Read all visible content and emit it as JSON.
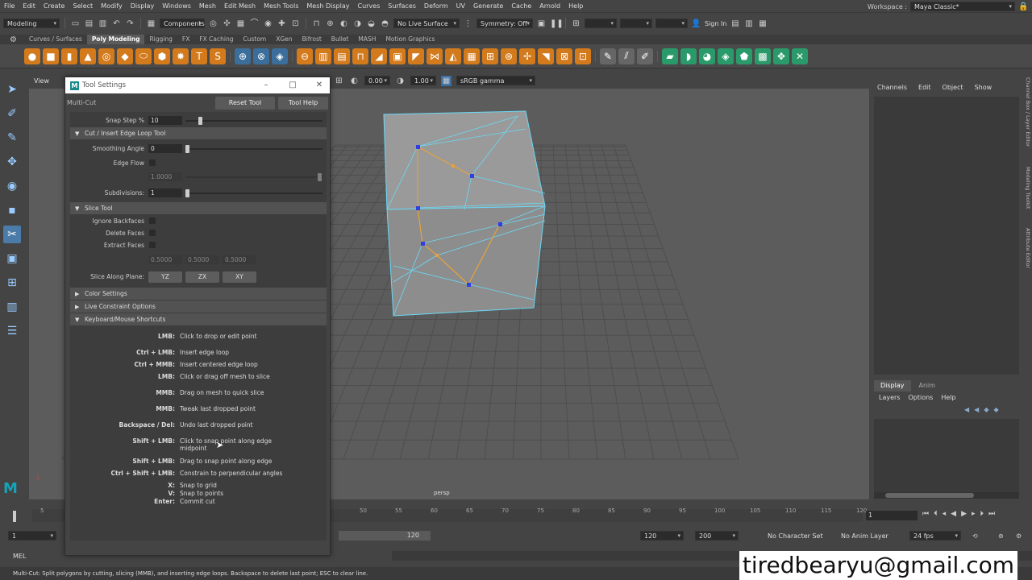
{
  "menu": [
    "File",
    "Edit",
    "Create",
    "Select",
    "Modify",
    "Display",
    "Windows",
    "Mesh",
    "Edit Mesh",
    "Mesh Tools",
    "Mesh Display",
    "Curves",
    "Surfaces",
    "Deform",
    "UV",
    "Generate",
    "Cache",
    "Arnold",
    "Help"
  ],
  "workspace": {
    "label": "Workspace :",
    "value": "Maya Classic*"
  },
  "status": {
    "mode": "Modeling",
    "components": "Components",
    "live_surface": "No Live Surface",
    "symmetry": "Symmetry: Off",
    "sign_in": "Sign In"
  },
  "shelf_tabs": [
    "Curves / Surfaces",
    "Poly Modeling",
    "Rigging",
    "FX",
    "FX Caching",
    "Custom",
    "XGen",
    "Bifrost",
    "Bullet",
    "MASH",
    "Motion Graphics"
  ],
  "shelf_active": "Poly Modeling",
  "viewport": {
    "menu_view": "View",
    "exposure": "0.00",
    "gamma": "1.00",
    "colorspace": "sRGB gamma",
    "camera": "persp"
  },
  "channel_box": {
    "tabs": [
      "Channels",
      "Edit",
      "Object",
      "Show"
    ]
  },
  "layer_editor": {
    "tabs": [
      "Display",
      "Anim"
    ],
    "menu": [
      "Layers",
      "Options",
      "Help"
    ]
  },
  "side_labels": [
    "Channel Box / Layer Editor",
    "Modeling Toolkit",
    "Attribute Editor"
  ],
  "tool_settings": {
    "window_title": "Tool Settings",
    "tool_name": "Multi-Cut",
    "reset_button": "Reset Tool",
    "help_button": "Tool Help",
    "snap_step": {
      "label": "Snap Step %",
      "value": "10"
    },
    "sections": {
      "cut_insert": "Cut / Insert Edge Loop Tool",
      "slice": "Slice Tool",
      "color": "Color Settings",
      "live": "Live Constraint Options",
      "keyboard": "Keyboard/Mouse Shortcuts"
    },
    "smoothing_angle": {
      "label": "Smoothing Angle",
      "value": "0"
    },
    "edge_flow": {
      "label": "Edge Flow",
      "value": "1.0000"
    },
    "subdivisions": {
      "label": "Subdivisions:",
      "value": "1"
    },
    "ignore_backfaces": "Ignore Backfaces",
    "delete_faces": "Delete Faces",
    "extract_faces": "Extract Faces",
    "extract_values": [
      "0.5000",
      "0.5000",
      "0.5000"
    ],
    "slice_plane": {
      "label": "Slice Along Plane:",
      "buttons": [
        "YZ",
        "ZX",
        "XY"
      ]
    },
    "shortcuts": [
      {
        "key": "LMB:",
        "desc": "Click to drop or edit point"
      },
      {
        "key": "Ctrl + LMB:",
        "desc": "Insert edge loop"
      },
      {
        "key": "Ctrl + MMB:",
        "desc": "Insert centered edge loop"
      },
      {
        "key": "LMB:",
        "desc": "Click or drag off mesh to slice"
      },
      {
        "key": "MMB:",
        "desc": "Drag on mesh to quick slice"
      },
      {
        "key": "MMB:",
        "desc": "Tweak last dropped point"
      },
      {
        "key": "Backspace / Del:",
        "desc": "Undo last dropped point"
      },
      {
        "key": "Shift + LMB:",
        "desc": "Click to snap point along edge midpoint"
      },
      {
        "key": "Shift + LMB:",
        "desc": "Drag to snap point along edge"
      },
      {
        "key": "Ctrl + Shift + LMB:",
        "desc": "Constrain to perpendicular angles"
      },
      {
        "key": "X:",
        "desc": "Snap to grid"
      },
      {
        "key": "V:",
        "desc": "Snap to points"
      },
      {
        "key": "Enter:",
        "desc": "Commit cut"
      }
    ]
  },
  "timeline": {
    "ticks": [
      "5",
      "50",
      "55",
      "60",
      "65",
      "70",
      "75",
      "80",
      "85",
      "90",
      "95",
      "100",
      "105",
      "110",
      "115",
      "120"
    ],
    "current": "1",
    "start": "1",
    "range_end": "120",
    "end1": "120",
    "end2": "200",
    "character_set": "No Character Set",
    "anim_layer": "No Anim Layer",
    "fps": "24 fps"
  },
  "mel_label": "MEL",
  "help_line": "Multi-Cut: Split polygons by cutting, slicing (MMB), and inserting edge loops. Backspace to delete last point; ESC to clear line.",
  "watermark": "tiredbearyu@gmail.com"
}
